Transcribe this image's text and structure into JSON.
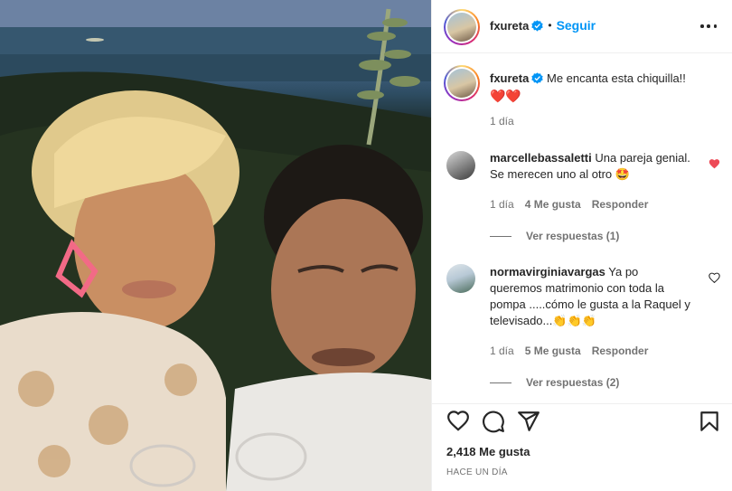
{
  "post": {
    "username": "fxureta",
    "follow_label": "Seguir",
    "separator": "•",
    "caption": {
      "username": "fxureta",
      "text": "Me encanta esta chiquilla!!",
      "emoji": "❤️❤️",
      "time": "1 día"
    },
    "comments": [
      {
        "username": "marcellebassaletti",
        "text": "Una pareja genial. Se merecen uno al otro 🤩",
        "time": "1 día",
        "likes": "4 Me gusta",
        "reply_label": "Responder",
        "view_replies": "Ver respuestas (1)",
        "liked": true
      },
      {
        "username": "normavirginiavargas",
        "text": "Ya po queremos matrimonio con toda la pompa .....cómo le gusta a la Raquel y televisado...👏👏👏",
        "time": "1 día",
        "likes": "5 Me gusta",
        "reply_label": "Responder",
        "view_replies": "Ver respuestas (2)",
        "liked": false
      }
    ],
    "likes_count": "2,418 Me gusta",
    "date": "HACE UN DÍA"
  },
  "colors": {
    "accent": "#0095f6",
    "like_red": "#ed4956",
    "verified_blue": "#0095f6",
    "muted": "#737373"
  },
  "icons": [
    "verified-badge-icon",
    "more-options-icon",
    "heart-icon",
    "comment-icon",
    "share-icon",
    "bookmark-icon"
  ]
}
